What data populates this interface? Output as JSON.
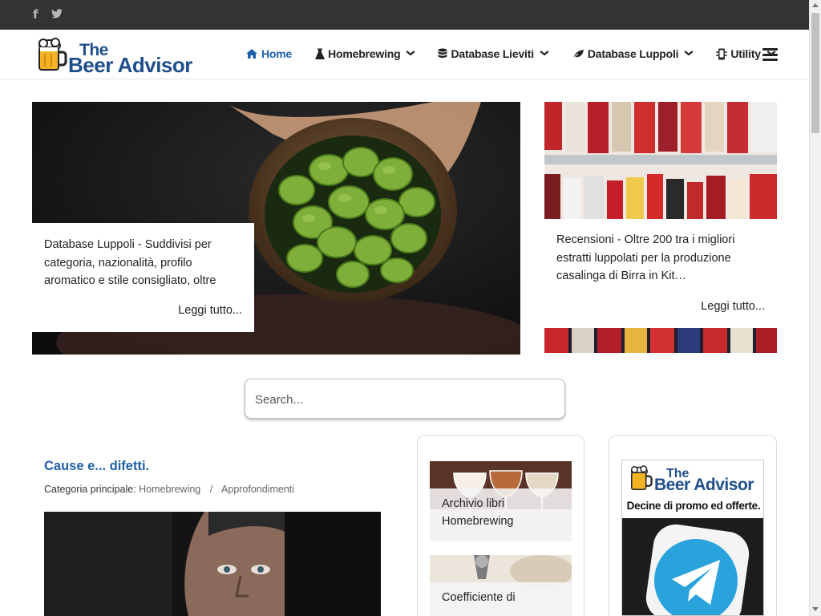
{
  "topbar": {
    "social": [
      {
        "icon": "facebook-icon",
        "glyph": "f"
      },
      {
        "icon": "twitter-icon",
        "glyph": "🐦"
      }
    ]
  },
  "header": {
    "logo_the": "The",
    "logo_name": "Beer Advisor",
    "nav": [
      {
        "label": "Home",
        "icon": "home-icon",
        "glyph": "⌂",
        "has_dropdown": false,
        "active": true
      },
      {
        "label": "Homebrewing",
        "icon": "flask-icon",
        "glyph": "⚗",
        "has_dropdown": true,
        "active": false
      },
      {
        "label": "Database Lieviti",
        "icon": "database-icon",
        "glyph": "☰",
        "has_dropdown": true,
        "active": false
      },
      {
        "label": "Database Luppoli",
        "icon": "leaf-icon",
        "glyph": "❦",
        "has_dropdown": true,
        "active": false
      },
      {
        "label": "Utility",
        "icon": "mobile-icon",
        "glyph": "▯",
        "has_dropdown": true,
        "active": false
      }
    ],
    "chevron_glyph": "⌄",
    "menu_icon": "hamburger-icon"
  },
  "hero": {
    "left": {
      "text": "Database Luppoli - Suddivisi per categoria, nazionalità, profilo aromatico e stile consigliato, oltre",
      "more": "Leggi tutto..."
    },
    "right": {
      "text": "Recensioni - Oltre 200 tra i migliori estratti luppolati per la produzione casalinga di Birra in Kit…",
      "more": "Leggi tutto..."
    }
  },
  "search": {
    "placeholder": "Search..."
  },
  "article": {
    "title": "Cause e... difetti.",
    "meta_prefix": "Categoria principale:",
    "category": "Homebrewing",
    "separator": "/",
    "subcategory": "Approfondimenti"
  },
  "sidebar": {
    "tiles": [
      {
        "label": "Archivio libri Homebrewing"
      },
      {
        "label": "Coefficiente di"
      }
    ],
    "promo": {
      "the": "The",
      "name": "Beer Advisor",
      "text": "Decine di promo ed offerte."
    }
  },
  "colors": {
    "topbar_bg": "#333333",
    "accent": "#1f5fa8",
    "logo": "#1f4e8c",
    "telegram": "#2aa3dd"
  }
}
